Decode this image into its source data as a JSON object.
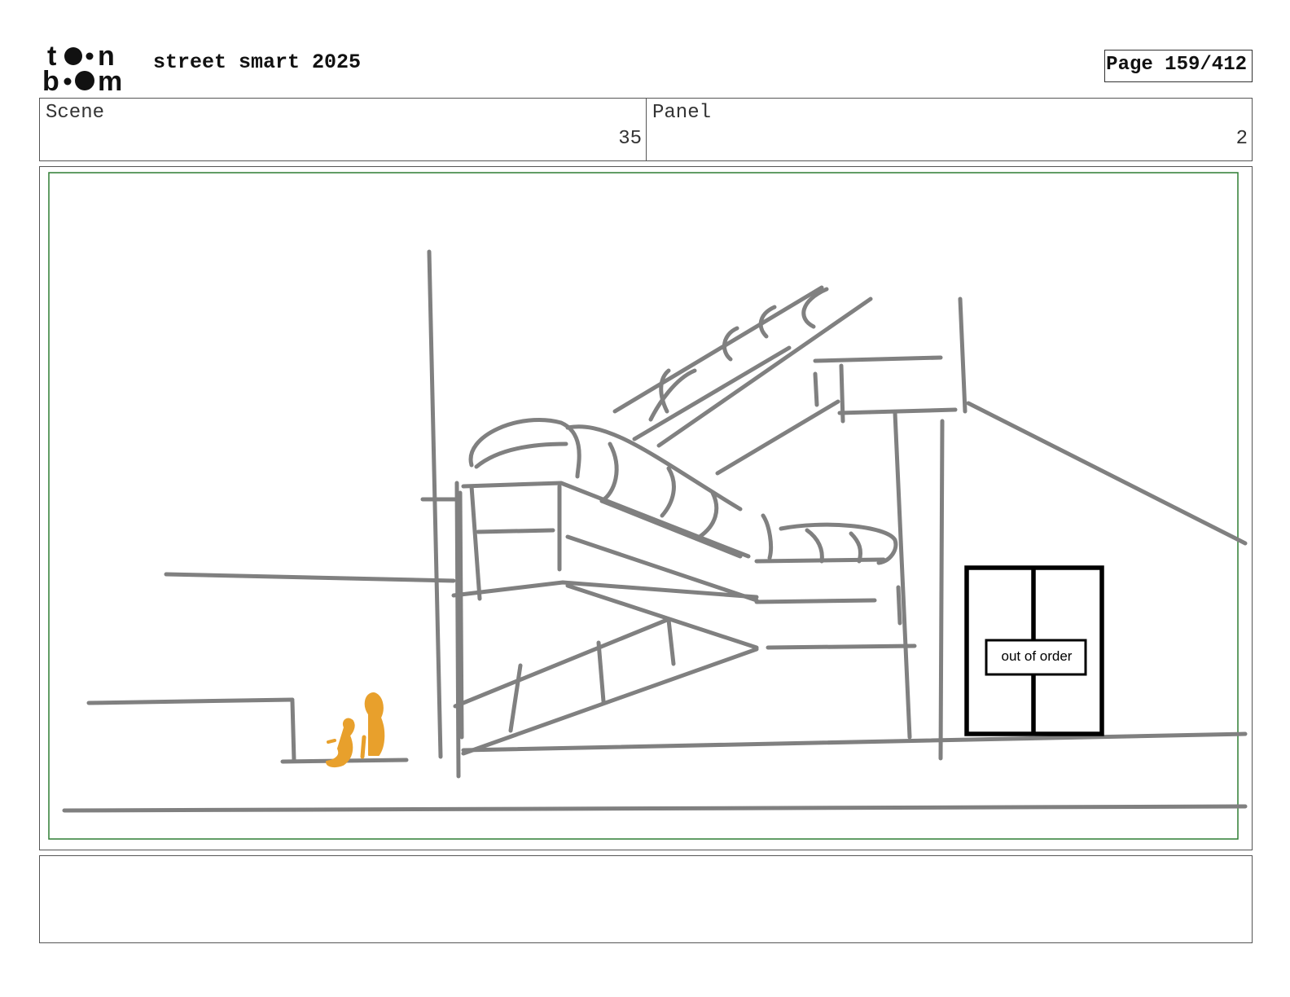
{
  "header": {
    "logo_name": "toon boom",
    "project_title": "street smart 2025",
    "page_indicator": "Page 159/412"
  },
  "info": {
    "scene_label": "Scene",
    "scene_value": "35",
    "panel_label": "Panel",
    "panel_value": "2"
  },
  "drawing": {
    "sign_text": "out of order",
    "colors": {
      "sketch_lines": "#808080",
      "figures": "#e8a02c",
      "safe_frame": "#2e7d32",
      "door": "#000000"
    }
  },
  "notes": {
    "text": ""
  }
}
